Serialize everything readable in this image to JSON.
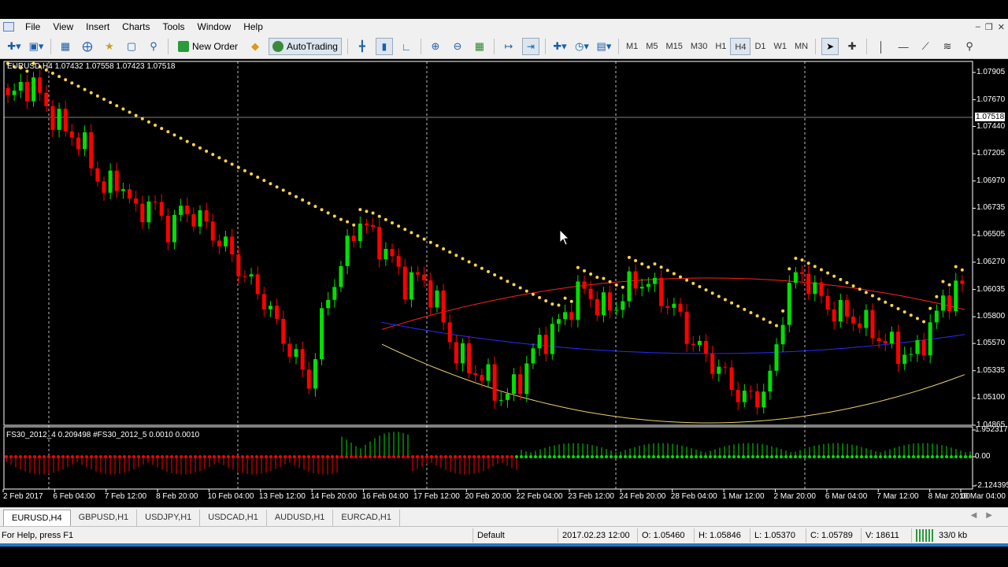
{
  "menu": [
    "File",
    "View",
    "Insert",
    "Charts",
    "Tools",
    "Window",
    "Help"
  ],
  "toolbar": {
    "new_order": "New Order",
    "autotrading": "AutoTrading",
    "timeframes": [
      "M1",
      "M5",
      "M15",
      "M30",
      "H1",
      "H4",
      "D1",
      "W1",
      "MN"
    ],
    "active_timeframe": "H4"
  },
  "chart": {
    "header": "EURUSD,H4  1.07432 1.07558 1.07423 1.07518",
    "current_price": "1.07518",
    "indicator_label": "FS30_2012_4 0.209498  #FS30_2012_5 0.0010 0.0010",
    "bull_color": "#00e000",
    "bear_color": "#ff0000",
    "psar_color": "#ffd24d"
  },
  "chart_data": {
    "type": "candlestick",
    "symbol": "EURUSD",
    "timeframe": "H4",
    "price_ticks": [
      "1.07905",
      "1.07670",
      "1.07440",
      "1.07205",
      "1.06970",
      "1.06735",
      "1.06505",
      "1.06270",
      "1.06035",
      "1.05800",
      "1.05570",
      "1.05335",
      "1.05100",
      "1.04865"
    ],
    "ylim": [
      1.04865,
      1.08
    ],
    "time_ticks": [
      "2 Feb 2017",
      "6 Feb 04:00",
      "7 Feb 12:00",
      "8 Feb 20:00",
      "10 Feb 04:00",
      "13 Feb 12:00",
      "14 Feb 20:00",
      "16 Feb 04:00",
      "17 Feb 12:00",
      "20 Feb 20:00",
      "22 Feb 04:00",
      "23 Feb 12:00",
      "24 Feb 20:00",
      "28 Feb 04:00",
      "1 Mar 12:00",
      "2 Mar 20:00",
      "6 Mar 04:00",
      "7 Mar 12:00",
      "8 Mar 20:00",
      "10 Mar 04:00"
    ],
    "indicator_ticks": [
      "1.952317",
      "0.00",
      "-2.124395"
    ],
    "indicator_ylim": [
      -2.124395,
      1.952317
    ],
    "close_path": [
      1.0765,
      1.0782,
      1.0772,
      1.0748,
      1.0738,
      1.0722,
      1.0688,
      1.07,
      1.0668,
      1.068,
      1.0655,
      1.0672,
      1.0665,
      1.065,
      1.0635,
      1.0612,
      1.0598,
      1.057,
      1.0545,
      1.0523,
      1.0595,
      1.0625,
      1.0665,
      1.0648,
      1.0632,
      1.0608,
      1.0615,
      1.059,
      1.0552,
      1.0536,
      1.0528,
      1.051,
      1.052,
      1.055,
      1.0565,
      1.058,
      1.0605,
      1.0592,
      1.0585,
      1.0606,
      1.0612,
      1.0598,
      1.0585,
      1.0558,
      1.0545,
      1.053,
      1.0512,
      1.0508,
      1.0528,
      1.0605,
      1.0618,
      1.0596,
      1.0584,
      1.058,
      1.0572,
      1.056,
      1.055,
      1.0545,
      1.0572,
      1.0598,
      1.0606
    ]
  },
  "tabs": [
    "EURUSD,H4",
    "GBPUSD,H1",
    "USDJPY,H1",
    "USDCAD,H1",
    "AUDUSD,H1",
    "EURCAD,H1"
  ],
  "active_tab": "EURUSD,H4",
  "status": {
    "help": "For Help, press F1",
    "profile": "Default",
    "datetime": "2017.02.23 12:00",
    "open": "O: 1.05460",
    "high": "H: 1.05846",
    "low": "L: 1.05370",
    "close": "C: 1.05789",
    "volume": "V: 18611",
    "traffic": "33/0 kb"
  }
}
